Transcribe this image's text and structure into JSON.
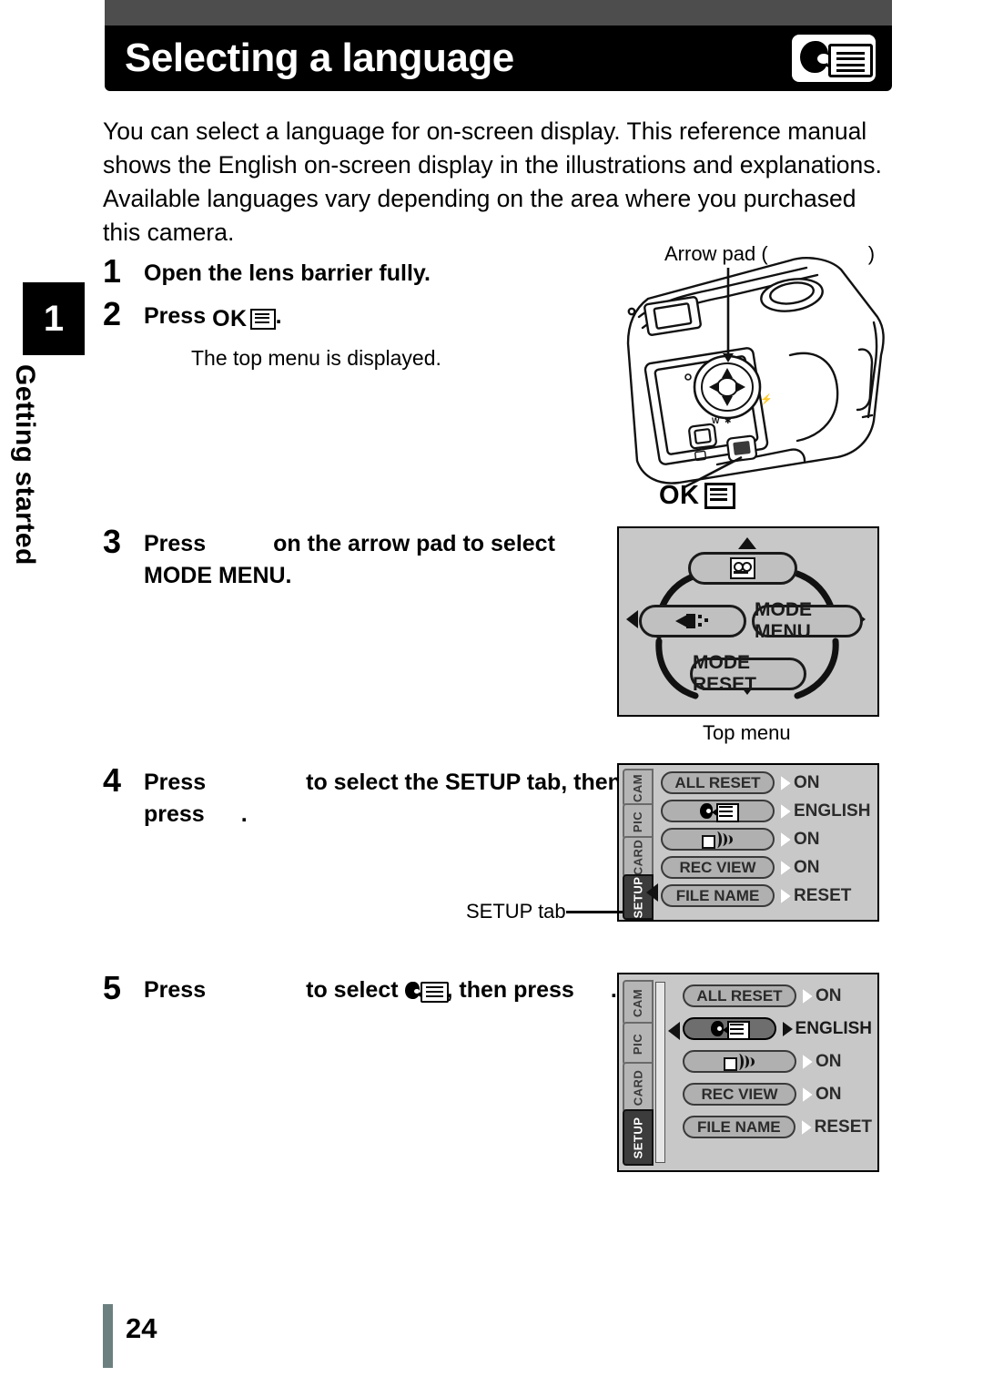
{
  "page": {
    "title": "Selecting a language",
    "number": "24",
    "chapter_number": "1",
    "chapter_label": "Getting started",
    "title_icon": "language-icon"
  },
  "intro": "You can select a language for on-screen display. This reference manual shows the English on-screen display in the illustrations and explanations. Available languages vary depending on the area where you purchased this camera.",
  "steps": [
    {
      "number": "1",
      "text": "Open the lens barrier fully."
    },
    {
      "number": "2",
      "text_before": "Press",
      "button": "OK",
      "button_icon": "menu-list-icon",
      "text_after": ".",
      "note": "The top menu is displayed."
    },
    {
      "number": "3",
      "text_before": "Press",
      "text_after": "on the arrow pad to select",
      "target": "MODE MENU."
    },
    {
      "number": "4",
      "text_before": "Press",
      "text_after": "to select the SETUP tab, then",
      "text_line2_before": "press",
      "text_line2_after": "."
    },
    {
      "number": "5",
      "text_before": "Press",
      "text_mid": "to select",
      "target_icon": "language-icon",
      "text_after": ", then press",
      "text_end": "."
    }
  ],
  "camera_figure": {
    "arrow_pad_label_before": "Arrow pad (",
    "arrow_pad_label_after": ")",
    "ok_label": "OK",
    "ok_icon": "menu-list-icon"
  },
  "top_menu": {
    "caption": "Top menu",
    "buttons": {
      "up": "movie-icon",
      "left": "flash-icon",
      "right": "MODE MENU",
      "down": "MODE RESET"
    },
    "arrows": [
      "up",
      "down",
      "left",
      "right"
    ]
  },
  "setup_tab_label": "SETUP tab",
  "setup_screens": [
    {
      "tabs": [
        "CAM",
        "PIC",
        "CARD",
        "SETUP"
      ],
      "active_tab": "SETUP",
      "rows": [
        {
          "label": "ALL RESET",
          "icon": null,
          "value": "ON",
          "selected": false
        },
        {
          "label": null,
          "icon": "language-icon",
          "value": "ENGLISH",
          "selected": false
        },
        {
          "label": null,
          "icon": "beep-icon",
          "value": "ON",
          "selected": false
        },
        {
          "label": "REC VIEW",
          "icon": null,
          "value": "ON",
          "selected": false
        },
        {
          "label": "FILE NAME",
          "icon": null,
          "value": "RESET",
          "selected": false
        }
      ]
    },
    {
      "tabs": [
        "CAM",
        "PIC",
        "CARD",
        "SETUP"
      ],
      "active_tab": "SETUP",
      "rows": [
        {
          "label": "ALL RESET",
          "icon": null,
          "value": "ON",
          "selected": false
        },
        {
          "label": null,
          "icon": "language-icon",
          "value": "ENGLISH",
          "selected": true
        },
        {
          "label": null,
          "icon": "beep-icon",
          "value": "ON",
          "selected": false
        },
        {
          "label": "REC VIEW",
          "icon": null,
          "value": "ON",
          "selected": false
        },
        {
          "label": "FILE NAME",
          "icon": null,
          "value": "RESET",
          "selected": false
        }
      ]
    }
  ],
  "colors": {
    "title_bar": "#000000",
    "top_bar": "#4d4d4d",
    "screen_bg": "#c8c8c8",
    "footer_bar": "#6d8080"
  }
}
